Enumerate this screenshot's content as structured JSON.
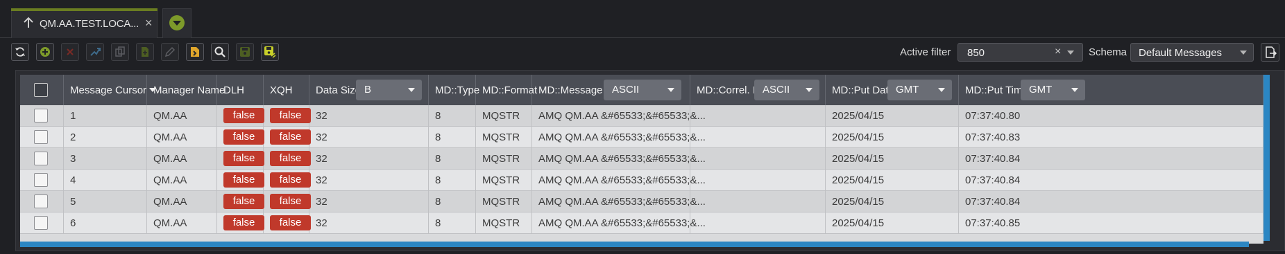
{
  "tab": {
    "label": "QM.AA.TEST.LOCA...",
    "close": "×"
  },
  "icons": {
    "tab_arrow": "arrow-up-icon",
    "tab_menu": "chevron-down-circle-icon",
    "toolbar": [
      "refresh-icon",
      "add-message-icon",
      "delete-icon",
      "move-icon",
      "copy-icon",
      "new-document-icon",
      "edit-icon",
      "load-icon",
      "search-icon",
      "save-icon",
      "save-all-icon"
    ],
    "export": "export-icon"
  },
  "toolbar": {
    "active_filter_label": "Active filter",
    "active_filter_value": "850",
    "filter_clear": "×",
    "schema_label": "Schema",
    "schema_value": "Default Messages"
  },
  "table": {
    "headers": {
      "message_cursor": "Message Cursor",
      "manager_name": "Manager Name",
      "dlh": "DLH",
      "xqh": "XQH",
      "data_size": "Data Size",
      "data_size_unit": "B",
      "md_type": "MD::Type",
      "md_format": "MD::Format",
      "md_message_id": "MD::Message ID",
      "md_message_id_enc": "ASCII",
      "md_correl_id": "MD::Correl. ID",
      "md_correl_id_enc": "ASCII",
      "md_put_date": "MD::Put Date",
      "md_put_date_tz": "GMT",
      "md_put_time": "MD::Put Time",
      "md_put_time_tz": "GMT"
    },
    "rows": [
      {
        "cursor": "1",
        "manager": "QM.AA",
        "dlh": "false",
        "xqh": "false",
        "size": "32",
        "type": "8",
        "format": "MQSTR",
        "msgid": "AMQ QM.AA &#65533;&#65533;&...",
        "correl": "",
        "date": "2025/04/15",
        "time": "07:37:40.80"
      },
      {
        "cursor": "2",
        "manager": "QM.AA",
        "dlh": "false",
        "xqh": "false",
        "size": "32",
        "type": "8",
        "format": "MQSTR",
        "msgid": "AMQ QM.AA &#65533;&#65533;&...",
        "correl": "",
        "date": "2025/04/15",
        "time": "07:37:40.83"
      },
      {
        "cursor": "3",
        "manager": "QM.AA",
        "dlh": "false",
        "xqh": "false",
        "size": "32",
        "type": "8",
        "format": "MQSTR",
        "msgid": "AMQ QM.AA &#65533;&#65533;&...",
        "correl": "",
        "date": "2025/04/15",
        "time": "07:37:40.84"
      },
      {
        "cursor": "4",
        "manager": "QM.AA",
        "dlh": "false",
        "xqh": "false",
        "size": "32",
        "type": "8",
        "format": "MQSTR",
        "msgid": "AMQ QM.AA &#65533;&#65533;&...",
        "correl": "",
        "date": "2025/04/15",
        "time": "07:37:40.84"
      },
      {
        "cursor": "5",
        "manager": "QM.AA",
        "dlh": "false",
        "xqh": "false",
        "size": "32",
        "type": "8",
        "format": "MQSTR",
        "msgid": "AMQ QM.AA &#65533;&#65533;&...",
        "correl": "",
        "date": "2025/04/15",
        "time": "07:37:40.84"
      },
      {
        "cursor": "6",
        "manager": "QM.AA",
        "dlh": "false",
        "xqh": "false",
        "size": "32",
        "type": "8",
        "format": "MQSTR",
        "msgid": "AMQ QM.AA &#65533;&#65533;&...",
        "correl": "",
        "date": "2025/04/15",
        "time": "07:37:40.85"
      }
    ]
  },
  "colors": {
    "tab_accent": "#6a7d21",
    "badge_false": "#c0392b",
    "scrollbar": "#2b86c3",
    "header_bg": "#4a4d55"
  }
}
